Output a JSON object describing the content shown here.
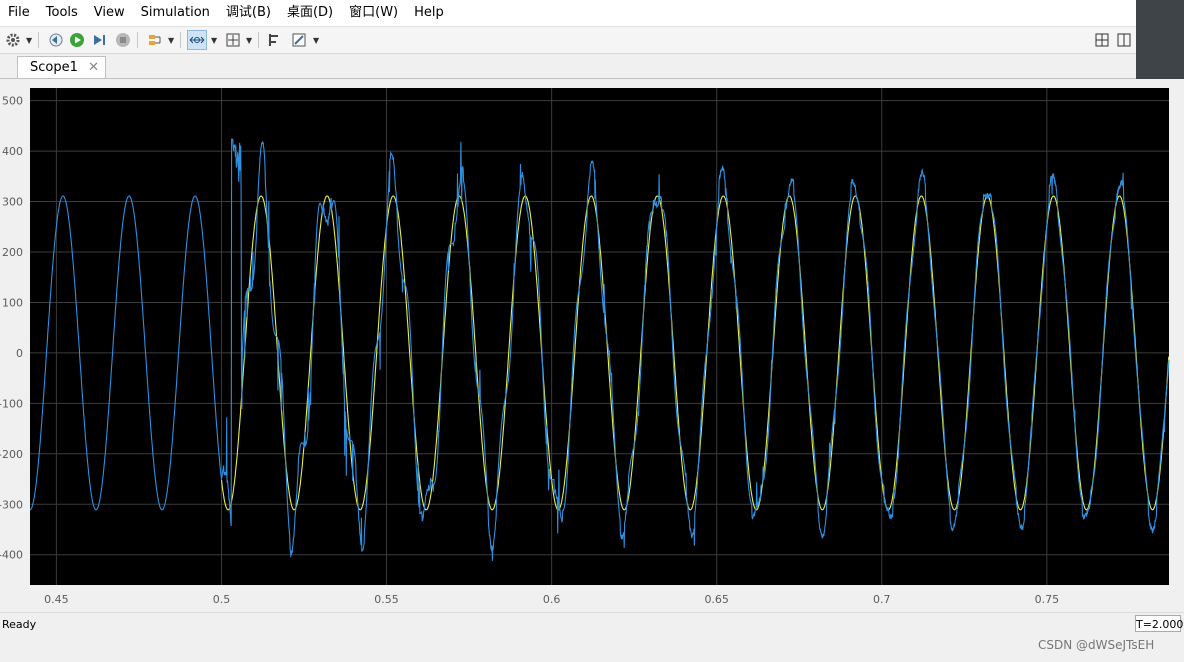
{
  "menu": {
    "items": [
      "File",
      "Tools",
      "View",
      "Simulation",
      "调试(B)",
      "桌面(D)",
      "窗口(W)",
      "Help"
    ]
  },
  "toolbar": {
    "icons": [
      "gear-icon",
      "step-back-icon",
      "run-icon",
      "step-forward-icon",
      "stop-icon",
      "signal-select-icon",
      "zoom-x-icon",
      "fit-to-view-icon",
      "cursor-measure-icon",
      "style-icon",
      "layout-grid-icon",
      "layout-split-icon"
    ]
  },
  "tabs": [
    {
      "label": "Scope1",
      "close": "✕"
    }
  ],
  "status": {
    "text": "Ready",
    "time": "T=2.000"
  },
  "watermark": "CSDN @dWSeJTsEH",
  "colors": {
    "plot_bg": "#000000",
    "grid": "#3c3c3c",
    "axis_text": "#5c5c5c",
    "series1": "#e8f04a",
    "series2": "#2f8fe0"
  },
  "chart_data": {
    "type": "line",
    "title": "",
    "xlabel": "",
    "ylabel": "",
    "xlim": [
      0.442,
      0.787
    ],
    "ylim": [
      -460,
      525
    ],
    "xticks": [
      0.45,
      0.5,
      0.55,
      0.6,
      0.65,
      0.7,
      0.75
    ],
    "xtick_labels": [
      "0.45",
      "0.5",
      "0.55",
      "0.6",
      "0.65",
      "0.7",
      "0.75"
    ],
    "yticks": [
      500,
      400,
      300,
      200,
      100,
      0,
      -100,
      -200,
      -300,
      -400
    ],
    "ytick_labels": [
      "500",
      "400",
      "300",
      "200",
      "100",
      "0",
      "-100",
      "-200",
      "-300",
      "-400"
    ],
    "grid": true,
    "series": [
      {
        "color": "#e8f04a",
        "amplitude": 311,
        "frequency_hz": 50,
        "start_x": 0.5,
        "values_desc": "sinusoid"
      },
      {
        "color": "#2f8fe0",
        "amplitude": 311,
        "frequency_hz": 50,
        "start_x": 0.442,
        "peak_max": 425,
        "trough_min": -333
      }
    ]
  }
}
